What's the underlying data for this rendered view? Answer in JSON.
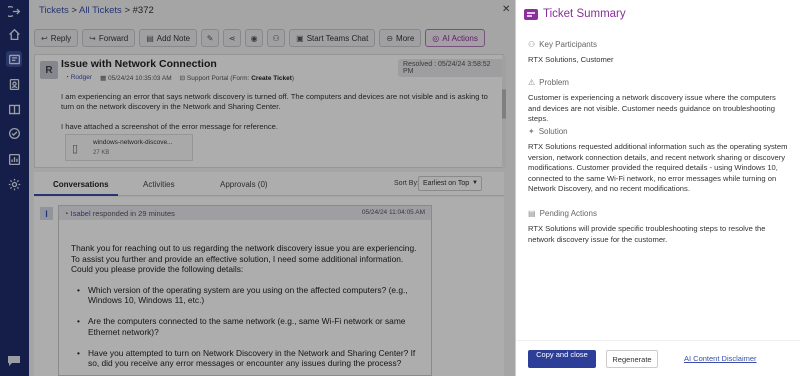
{
  "breadcrumb": {
    "tickets": "Tickets",
    "sep1": " > ",
    "all_tickets": "All Tickets",
    "sep2": " > ",
    "current": "#372"
  },
  "toolbar": {
    "reply": "Reply",
    "forward": "Forward",
    "add_note": "Add Note",
    "teams_chat": "Start Teams Chat",
    "more": "More",
    "ai_actions": "AI Actions"
  },
  "ticket": {
    "avatar_letter": "R",
    "title": "Issue with Network Connection",
    "resolved": "Resolved : 05/24/24 3:58:52 PM",
    "sender": "Rodger",
    "datetime": "05/24/24 10:35:03 AM",
    "portal_prefix": "Support Portal (Form: ",
    "portal_form": "Create Ticket",
    "portal_suffix": ")",
    "body_p1": "I am experiencing an error that says network discovery is turned off. The computers and devices are not visible and is asking to turn on the network discovery in the Network and Sharing Center.",
    "body_p2": "I have attached a screenshot of the error message for reference.",
    "attachment_name": "windows-network-discove...",
    "attachment_size": "27 KB"
  },
  "tabs": {
    "conversations": "Conversations",
    "activities": "Activities",
    "approvals": "Approvals (0)"
  },
  "sort": {
    "label": "Sort By:",
    "value": "Earliest on Top"
  },
  "conversation": {
    "marker": "I",
    "agent": "Isabel",
    "responded": " responded in 29 minutes",
    "timestamp": "05/24/24 11:04:05 AM",
    "intro": "Thank you for reaching out to us regarding the network discovery issue you are experiencing. To assist you further and provide an effective solution, I need some additional information. Could you please provide the following details:",
    "q1": "Which version of the operating system are you using on the affected computers? (e.g., Windows 10, Windows 11, etc.)",
    "q2": "Are the computers connected to the same network (e.g., same Wi-Fi network or same Ethernet network)?",
    "q3": "Have you attempted to turn on Network Discovery in the Network and Sharing Center? If so, did you receive any error messages or encounter any issues during the process?"
  },
  "summary": {
    "title": "Ticket Summary",
    "participants_h": "Key Participants",
    "participants": "RTX Solutions, Customer",
    "problem_h": "Problem",
    "problem": "Customer is experiencing a network discovery issue where the computers and devices are not visible. Customer needs guidance on troubleshooting steps.",
    "solution_h": "Solution",
    "solution": "RTX Solutions requested additional information such as the operating system version, network connection details, and recent network sharing or discovery modifications. Customer provided the required details - using Windows 10, connected to the same Wi-Fi network, no error messages while turning on Network Discovery, and no recent modifications.",
    "pending_h": "Pending Actions",
    "pending": "RTX Solutions will provide specific troubleshooting steps to resolve the network discovery issue for the customer.",
    "copy_close": "Copy and close",
    "regenerate": "Regenerate",
    "disclaimer": "AI Content Disclaimer"
  },
  "colors": {
    "nav": "#1e2d6b",
    "accent": "#3a4ea8",
    "ai_purple": "#8a2f9b",
    "primary_button": "#2c3e98"
  }
}
